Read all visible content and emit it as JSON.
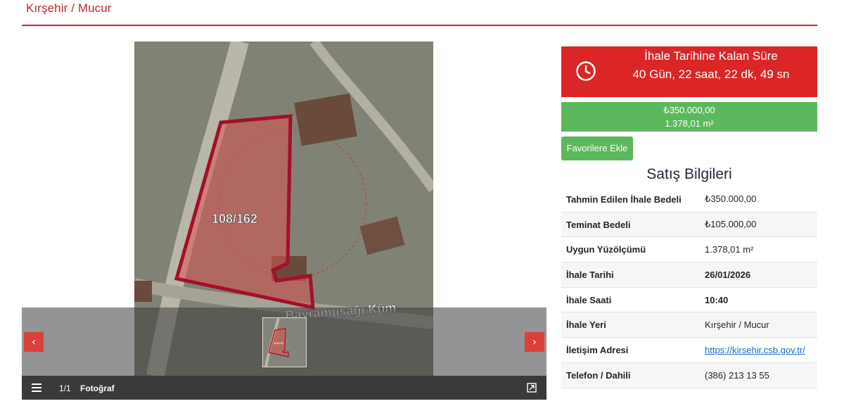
{
  "header": {
    "title": "Kırşehir / Mucur"
  },
  "gallery": {
    "counter": "1/1",
    "photo_label": "Fotoğraf",
    "parcel_label": "108/162",
    "map_text": "Bayramuşağı Küm",
    "thumb_parcel_label": "108/162",
    "prev_symbol": "‹",
    "next_symbol": "›",
    "icons": {
      "list": "list-icon",
      "expand": "expand-icon",
      "prev": "chevron-left-icon",
      "next": "chevron-right-icon"
    }
  },
  "countdown": {
    "title": "İhale Tarihine Kalan Süre",
    "value": "40 Gün, 22 saat, 22 dk, 49 sn",
    "icon": "clock-icon",
    "color": "#dc2626"
  },
  "price": {
    "amount": "₺350.000,00",
    "area": "1.378,01 m²",
    "color": "#5cb85c"
  },
  "favorite_button": {
    "label": "Favorilere Ekle"
  },
  "sales_info": {
    "title": "Satış Bilgileri",
    "rows": [
      {
        "key": "Tahmin Edilen İhale Bedeli",
        "value": "₺350.000,00"
      },
      {
        "key": "Teminat Bedeli",
        "value": "₺105.000,00"
      },
      {
        "key": "Uygun Yüzölçümü",
        "value": "1.378,01 m²"
      },
      {
        "key": "İhale Tarihi",
        "value": "26/01/2026"
      },
      {
        "key": "İhale Saati",
        "value": "10:40"
      },
      {
        "key": "İhale Yeri",
        "value": "Kırşehir / Mucur"
      },
      {
        "key": "İletişim Adresi",
        "value": "https://kirsehir.csb.gov.tr/"
      },
      {
        "key": "Telefon / Dahili",
        "value": "(386) 213 13 55"
      }
    ]
  },
  "accent_color": "#c4262e"
}
